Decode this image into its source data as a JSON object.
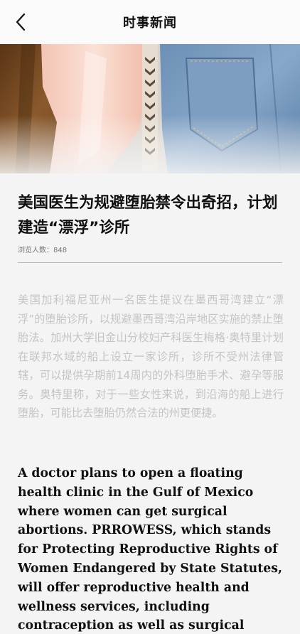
{
  "header": {
    "title": "时事新闻",
    "back_icon": "chevron-left-icon"
  },
  "article": {
    "title": "美国医生为规避堕胎禁令出奇招，计划建造“漂浮”诊所",
    "views_label": "浏览人数：848",
    "body_cn": "美国加利福尼亚州一名医生提议在墨西哥湾建立“漂浮”的堕胎诊所，以规避墨西哥湾沿岸地区实施的禁止堕胎法。加州大学旧金山分校妇产科医生梅格·奥特里计划在联邦水域的船上设立一家诊所，诊所不受州法律管辖，可以提供孕期前14周内的外科堕胎手术、避孕等服务。奥特里称，对于一些女性来说，到沿海的船上进行堕胎，可能比去堕胎仍然合法的州更便捷。",
    "body_en": "A doctor plans to open a floating health clinic in the Gulf of Mexico where women can get surgical abortions. PRROWESS, which stands for Protecting Reproductive Rights of Women Endangered by State Statutes, will offer reproductive health and wellness services, including contraception as well as surgical"
  },
  "colors": {
    "header_bg": "#fafafa",
    "page_bg": "#f4f4f4",
    "muted_text": "#c4c4c4",
    "divider": "#b8b8b8"
  }
}
